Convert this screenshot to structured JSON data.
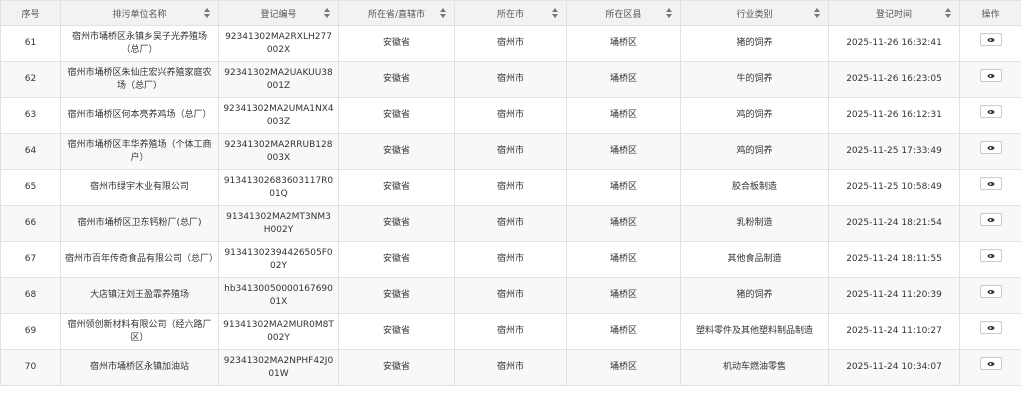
{
  "columns": [
    {
      "label": "序号",
      "sortable": false
    },
    {
      "label": "排污单位名称",
      "sortable": true
    },
    {
      "label": "登记编号",
      "sortable": true
    },
    {
      "label": "所在省/直辖市",
      "sortable": true
    },
    {
      "label": "所在市",
      "sortable": true
    },
    {
      "label": "所在区县",
      "sortable": true
    },
    {
      "label": "行业类别",
      "sortable": true
    },
    {
      "label": "登记时间",
      "sortable": true
    },
    {
      "label": "操作",
      "sortable": false
    }
  ],
  "rows": [
    {
      "no": "61",
      "name": "宿州市埇桥区永镇乡吴子光养殖场（总厂）",
      "reg": "92341302MA2RXLH277002X",
      "province": "安徽省",
      "city": "宿州市",
      "district": "埇桥区",
      "industry": "猪的饲养",
      "time": "2025-11-26 16:32:41"
    },
    {
      "no": "62",
      "name": "宿州市埇桥区朱仙庄宏兴养殖家庭农场（总厂）",
      "reg": "92341302MA2UAKUU38001Z",
      "province": "安徽省",
      "city": "宿州市",
      "district": "埇桥区",
      "industry": "牛的饲养",
      "time": "2025-11-26 16:23:05"
    },
    {
      "no": "63",
      "name": "宿州市埇桥区何本亮养鸡场（总厂）",
      "reg": "92341302MA2UMA1NX4003Z",
      "province": "安徽省",
      "city": "宿州市",
      "district": "埇桥区",
      "industry": "鸡的饲养",
      "time": "2025-11-26 16:12:31"
    },
    {
      "no": "64",
      "name": "宿州市埇桥区丰华养殖场（个体工商户）",
      "reg": "92341302MA2RRUB128003X",
      "province": "安徽省",
      "city": "宿州市",
      "district": "埇桥区",
      "industry": "鸡的饲养",
      "time": "2025-11-25 17:33:49"
    },
    {
      "no": "65",
      "name": "宿州市绿宇木业有限公司",
      "reg": "91341302683603117R001Q",
      "province": "安徽省",
      "city": "宿州市",
      "district": "埇桥区",
      "industry": "胶合板制造",
      "time": "2025-11-25 10:58:49"
    },
    {
      "no": "66",
      "name": "宿州市埇桥区卫东钙粉厂(总厂)",
      "reg": "91341302MA2MT3NM3H002Y",
      "province": "安徽省",
      "city": "宿州市",
      "district": "埇桥区",
      "industry": "乳粉制造",
      "time": "2025-11-24 18:21:54"
    },
    {
      "no": "67",
      "name": "宿州市百年传奇食品有限公司（总厂）",
      "reg": "91341302394426505F002Y",
      "province": "安徽省",
      "city": "宿州市",
      "district": "埇桥区",
      "industry": "其他食品制造",
      "time": "2025-11-24 18:11:55"
    },
    {
      "no": "68",
      "name": "大店镇汪刘王盈霏养殖场",
      "reg": "hb34130050000167690 01X",
      "province": "安徽省",
      "city": "宿州市",
      "district": "埇桥区",
      "industry": "猪的饲养",
      "time": "2025-11-24 11:20:39"
    },
    {
      "no": "69",
      "name": "宿州领创新材料有限公司（经六路厂区）",
      "reg": "91341302MA2MUR0M8T002Y",
      "province": "安徽省",
      "city": "宿州市",
      "district": "埇桥区",
      "industry": "塑料零件及其他塑料制品制造",
      "time": "2025-11-24 11:10:27"
    },
    {
      "no": "70",
      "name": "宿州市埇桥区永镇加油站",
      "reg": "92341302MA2NPHF42J001W",
      "province": "安徽省",
      "city": "宿州市",
      "district": "埇桥区",
      "industry": "机动车燃油零售",
      "time": "2025-11-24 10:34:07"
    }
  ]
}
